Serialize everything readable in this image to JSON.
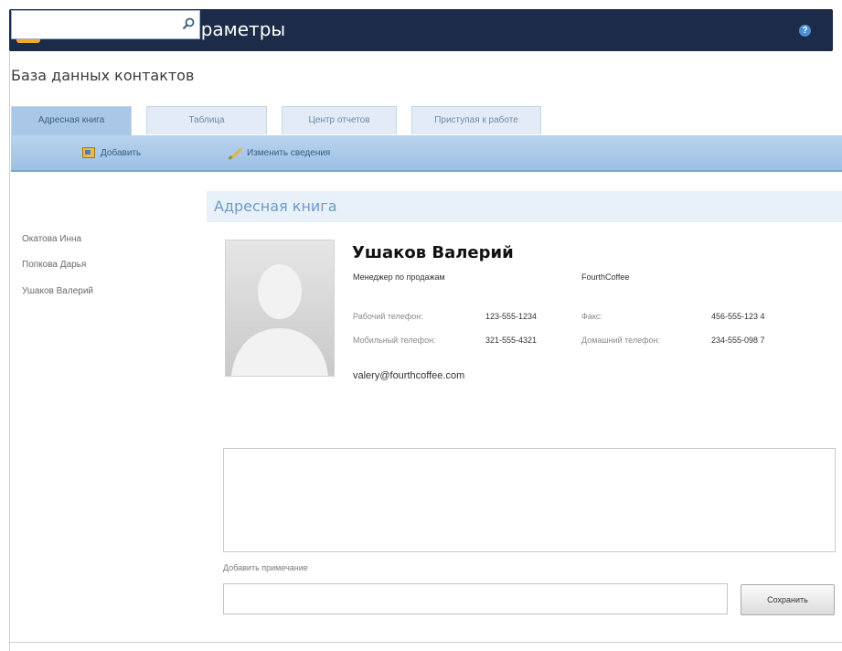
{
  "window": {
    "title": "Контакты > Параметры",
    "help_glyph": "?"
  },
  "subtitle": "База данных контактов",
  "tabs": [
    {
      "label": "Адресная книга",
      "active": true
    },
    {
      "label": "Таблица",
      "active": false
    },
    {
      "label": "Центр отчетов",
      "active": false
    },
    {
      "label": "Приступая к работе",
      "active": false
    }
  ],
  "toolbar": {
    "add_label": "Добавить",
    "edit_label": "Изменить сведения"
  },
  "search": {
    "value": "",
    "placeholder": ""
  },
  "contacts": [
    {
      "name": "Окатова Инна"
    },
    {
      "name": "Попкова Дарья"
    },
    {
      "name": "Ушаков Валерий"
    }
  ],
  "section": {
    "title": "Адресная книга"
  },
  "contact": {
    "name": "Ушаков Валерий",
    "job_title": "Менеджер по продажам",
    "company": "FourthCoffee",
    "work_phone_label": "Рабочий телефон:",
    "work_phone": "123-555-1234",
    "fax_label": "Факс:",
    "fax": "456-555-123 4",
    "mobile_phone_label": "Мобильный телефон:",
    "mobile_phone": "321-555-4321",
    "home_phone_label": "Домашний телефон:",
    "home_phone": "234-555-098 7",
    "email": "valery@fourthcoffee.com"
  },
  "notes": {
    "content": "",
    "add_label": "Добавить примечание",
    "input_value": "",
    "save_label": "Сохранить"
  },
  "colors": {
    "titlebar": "#1c2b47",
    "accent": "#a9c8e8",
    "section_title": "#6c9bc9",
    "app_icon": "#f4a928"
  },
  "icons": [
    "app-icon",
    "help-icon",
    "add-contact-icon",
    "edit-icon",
    "search-icon",
    "contact-photo-placeholder"
  ]
}
